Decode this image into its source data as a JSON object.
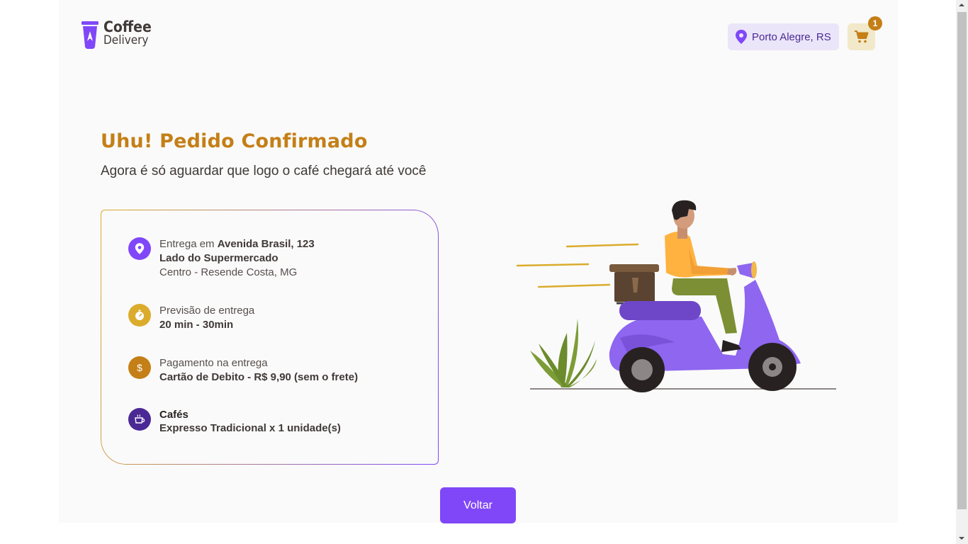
{
  "header": {
    "logo": {
      "line1": "Coffee",
      "line2": "Delivery"
    },
    "location": "Porto Alegre, RS",
    "cart_count": "1"
  },
  "confirmation": {
    "title": "Uhu! Pedido Confirmado",
    "subtitle": "Agora é só aguardar que logo o café chegará até você"
  },
  "details": {
    "delivery": {
      "prefix": "Entrega em",
      "street": "Avenida Brasil, 123",
      "complement": "Lado do Supermercado",
      "district_city": "Centro - Resende Costa, MG",
      "icon": "map-pin-icon",
      "icon_color": "#8047f8"
    },
    "forecast": {
      "label": "Previsão de entrega",
      "time": "20 min - 30min",
      "icon": "timer-icon",
      "icon_color": "#dbac2c"
    },
    "payment": {
      "label": "Pagamento na entrega",
      "method": "Cartão de Debito - R$ 9,90 (sem o frete)",
      "icon": "currency-dollar-icon",
      "icon_color": "#c47f17"
    },
    "coffees": {
      "heading": "Cafés",
      "items": "Expresso Tradicional x 1 unidade(s)",
      "icon": "coffee-cup-icon",
      "icon_color": "#4b2995"
    }
  },
  "actions": {
    "back_label": "Voltar"
  },
  "colors": {
    "brand_purple": "#8047f8",
    "purple_dark": "#4b2995",
    "yellow": "#dbac2c",
    "yellow_dark": "#c47f17"
  }
}
